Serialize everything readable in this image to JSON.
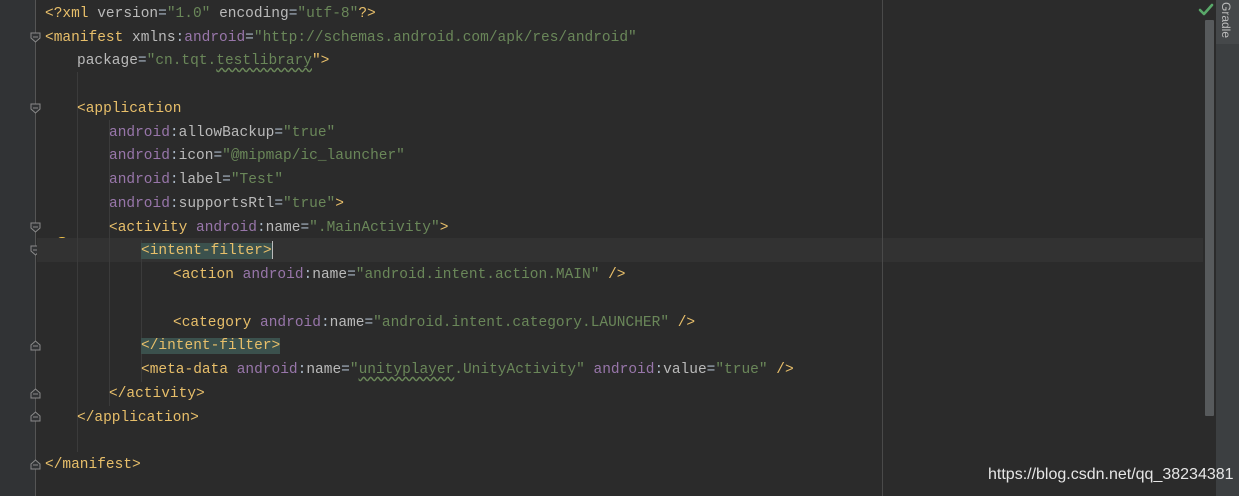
{
  "xml": {
    "decl_open": "<?",
    "decl_name": "xml",
    "decl_version_attr": "version",
    "decl_version_value": "\"1.0\"",
    "decl_encoding_attr": "encoding",
    "decl_encoding_value": "\"utf-8\"",
    "decl_close": "?>",
    "manifest_open": "<manifest",
    "xmlns_prefix": "xmlns",
    "android_ns": "android",
    "xmlns_value": "\"http://schemas.android.com/apk/res/android\"",
    "package_attr": "package",
    "package_value_q": "\"",
    "package_value_a": "cn.tqt.",
    "package_value_b": "testlibrary",
    "package_close": "\">",
    "application_open": "<application",
    "allow_backup_attr": "allowBackup",
    "allow_backup_value": "\"true\"",
    "icon_attr": "icon",
    "icon_value": "\"@mipmap/ic_launcher\"",
    "label_attr": "label",
    "label_value": "\"Test\"",
    "supports_rtl_attr": "supportsRtl",
    "supports_rtl_value": "\"true\"",
    "activity_open": "<activity",
    "name_attr": "name",
    "activity_name_value": "\".MainActivity\"",
    "intent_filter_open": "<intent-filter>",
    "action_open": "<action",
    "action_name_value": "\"android.intent.action.MAIN\"",
    "category_open": "<category",
    "category_name_value": "\"android.intent.category.LAUNCHER\"",
    "self_close": "/>",
    "gt": ">",
    "eq": "=",
    "intent_filter_close": "</intent-filter>",
    "meta_data_open": "<meta-data",
    "meta_name_q": "\"",
    "meta_name_a": "unityplayer",
    "meta_name_b": ".UnityActivity\"",
    "value_attr": "value",
    "meta_value_value": "\"true\"",
    "activity_close": "</activity>",
    "application_close": "</application>",
    "manifest_close": "</manifest>"
  },
  "side_panel": {
    "gradle_label": "Gradle"
  },
  "icons": {
    "status": "check-icon",
    "intention": "lightbulb-icon",
    "fold": "fold-icon"
  },
  "watermark": "https://blog.csdn.net/qq_38234381",
  "colors": {
    "background": "#2b2b2b",
    "tag": "#e8bf6a",
    "attribute": "#bababa",
    "namespace": "#9876aa",
    "string": "#6a8759",
    "match_highlight": "#3b514d"
  }
}
